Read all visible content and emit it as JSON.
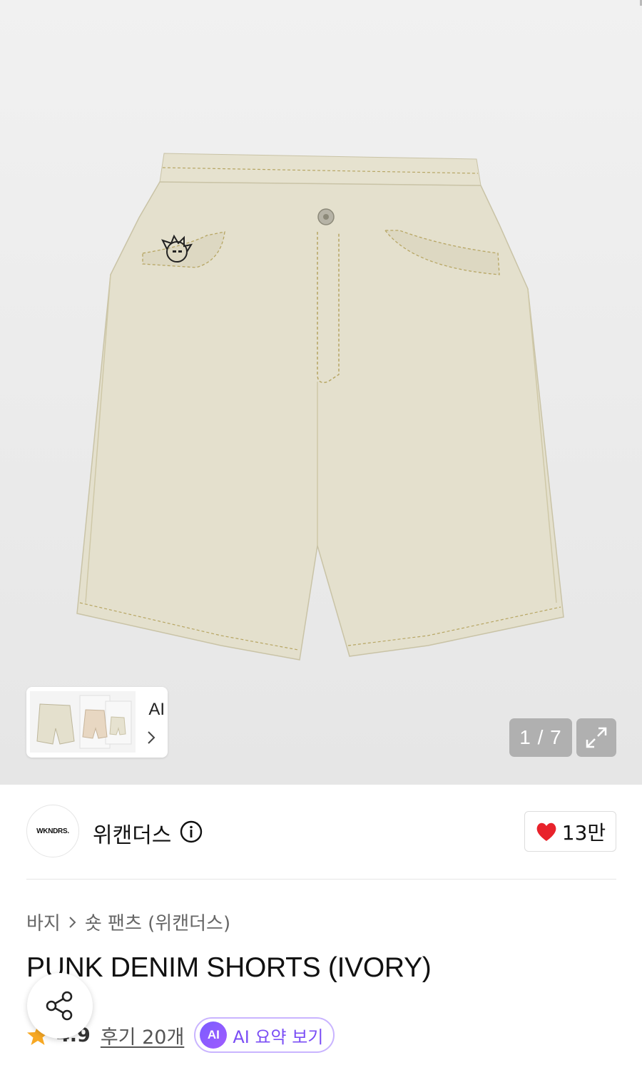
{
  "gallery": {
    "counter": "1 / 7",
    "ai_label": "AI"
  },
  "brand": {
    "logo_text": "WKNDRS.",
    "name": "위캔더스",
    "likes": "13만"
  },
  "breadcrumb": {
    "category": "바지",
    "subcategory": "숏 팬츠 (위캔더스)"
  },
  "product": {
    "title": "PUNK DENIM SHORTS (IVORY)"
  },
  "rating": {
    "value": "4.9",
    "reviews": "후기 20개",
    "ai_badge": "AI",
    "ai_summary": "AI 요약 보기"
  },
  "colors": {
    "heart": "#e8222b",
    "star": "#f7a823",
    "ai_accent": "#7a4df5"
  }
}
